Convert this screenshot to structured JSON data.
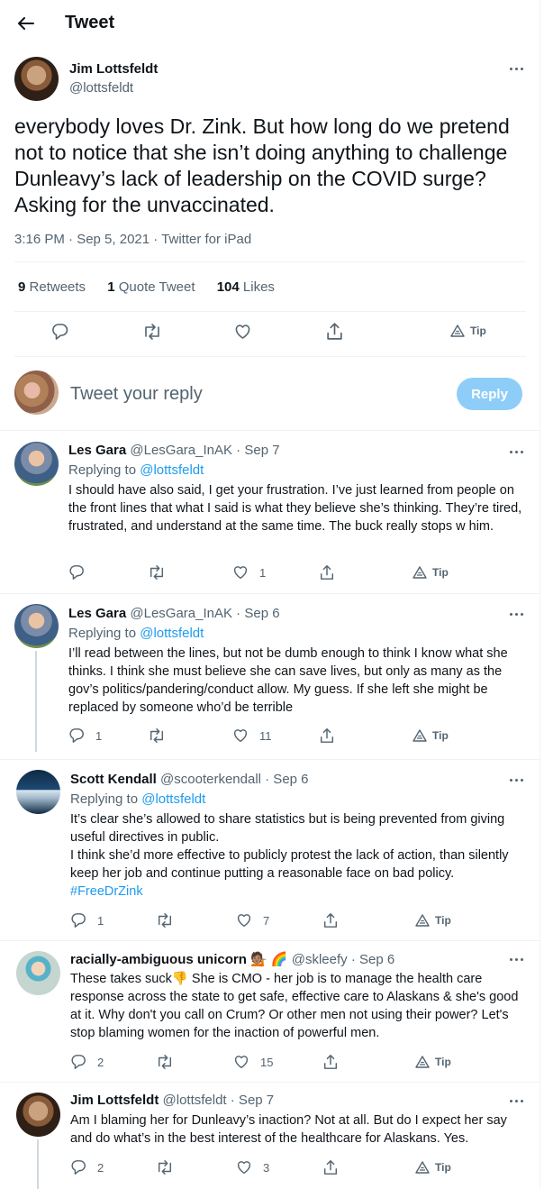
{
  "header": {
    "title": "Tweet"
  },
  "main_tweet": {
    "name": "Jim Lottsfeldt",
    "handle": "@lottsfeldt",
    "text": "everybody loves Dr. Zink.   But how long do we pretend not to notice that she isn’t doing anything to challenge Dunleavy’s lack of leadership on the COVID surge? Asking for the unvaccinated.",
    "meta": "3:16 PM · Sep 5, 2021 · Twitter for iPad",
    "stats": [
      {
        "count": "9",
        "label": "Retweets"
      },
      {
        "count": "1",
        "label": "Quote Tweet"
      },
      {
        "count": "104",
        "label": "Likes"
      }
    ],
    "tip_label": "Tip"
  },
  "reply_box": {
    "placeholder": "Tweet your reply",
    "button": "Reply"
  },
  "replies": [
    {
      "name": "Les Gara",
      "handle_date": "@LesGara_InAK · Sep 7",
      "replying_prefix": "Replying to",
      "replying_handle": "@lottsfeldt",
      "text": "I should have also said, I get your frustration. I’ve just learned from people on the front lines that what I said is what they believe she’s thinking. They’re tired, frustrated, and understand at the same time. The buck really stops w him.",
      "reply_count": "",
      "retweet_count": "",
      "like_count": "1",
      "tip": "Tip"
    },
    {
      "name": "Les Gara",
      "handle_date": "@LesGara_InAK · Sep 6",
      "replying_prefix": "Replying to",
      "replying_handle": "@lottsfeldt",
      "text": "I’ll read between the lines, but not be dumb enough to think I know what she thinks. I think she must believe she can save lives, but only as many as the gov’s politics/pandering/conduct allow. My guess. If she left she might be replaced by someone who’d be terrible",
      "reply_count": "1",
      "retweet_count": "",
      "like_count": "11",
      "tip": "Tip"
    },
    {
      "name": "Scott Kendall",
      "handle_date": "@scooterkendall · Sep 6",
      "replying_prefix": "Replying to",
      "replying_handle": "@lottsfeldt",
      "text": "It’s clear she’s allowed to share statistics but is being prevented from  giving useful directives in public.",
      "text2": "I think she’d more effective to publicly protest the lack of action, than silently keep her job and continue putting a reasonable face on bad policy.",
      "hashtag": "#FreeDrZink",
      "reply_count": "1",
      "retweet_count": "",
      "like_count": "7",
      "tip": "Tip"
    },
    {
      "name": "racially-ambiguous unicorn 💁🏽 🌈",
      "handle_date": "@skleefy · Sep 6",
      "text": "These takes suck👎 She is CMO - her job is to manage the health care response across the state to get safe, effective care to Alaskans & she's good at it. Why don't you call on Crum? Or other men not using their power? Let's stop blaming women for the inaction of powerful men.",
      "reply_count": "2",
      "retweet_count": "",
      "like_count": "15",
      "tip": "Tip"
    },
    {
      "name": "Jim Lottsfeldt",
      "handle_date": "@lottsfeldt · Sep 7",
      "text": "Am I blaming her for Dunleavy’s inaction?  Not at all. But do I expect her say and do what’s in the best interest of the healthcare for Alaskans.  Yes.",
      "reply_count": "2",
      "retweet_count": "",
      "like_count": "3",
      "tip": "Tip"
    }
  ]
}
